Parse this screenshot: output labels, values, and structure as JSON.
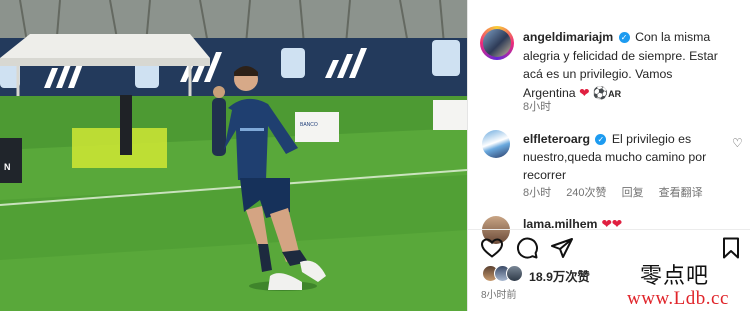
{
  "post": {
    "author": "angeldimariajm",
    "caption_line1": "Con la misma",
    "caption_line2": "alegria y felicidad de siempre. Estar",
    "caption_line3": "acá es un privilegio. Vamos",
    "caption_line4": "Argentina",
    "caption_tail": "AR",
    "time": "8小时"
  },
  "comments": [
    {
      "author": "elfleteroarg",
      "text_line1": "El privilegio es",
      "text_line2": "nuestro,queda mucho camino por",
      "text_line3": "recorrer",
      "time": "8小时",
      "likes": "240次赞",
      "reply": "回复",
      "translate": "查看翻译"
    },
    {
      "author": "lama.milhem",
      "hearts": "❤❤"
    }
  ],
  "engagement": {
    "likes": "18.9万次赞",
    "posted": "8小时前"
  },
  "icons": {
    "like": "heart-icon",
    "comment": "comment-icon",
    "share": "share-icon",
    "save": "bookmark-icon",
    "verified": "verified-badge-icon"
  },
  "colors": {
    "verified": "#1d9bf0",
    "heart": "#e02040",
    "watermark_red": "#e0242a"
  },
  "watermark": {
    "cn": "零点吧",
    "url": "www.Ldb.cc"
  },
  "photo": {
    "banner_text": "BANCO GALICIA"
  }
}
